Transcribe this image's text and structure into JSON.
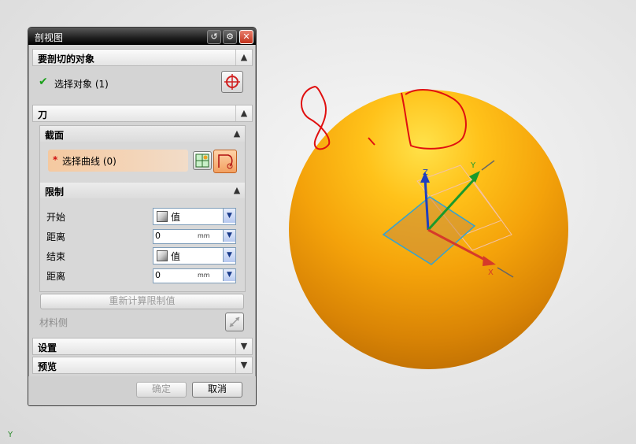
{
  "dialog": {
    "title": "剖视图",
    "section_objects": {
      "label": "要剖切的对象",
      "select_object": "选择对象 (1)"
    },
    "section_knife": {
      "label": "刀"
    },
    "section_plane": {
      "label": "截面",
      "select_curve": "选择曲线 (0)"
    },
    "section_limits": {
      "label": "限制",
      "start_label": "开始",
      "start_value": "值",
      "start_distance_label": "距离",
      "start_distance_value": "0",
      "end_label": "结束",
      "end_value": "值",
      "end_distance_label": "距离",
      "end_distance_value": "0",
      "unit": "mm",
      "recalc_button": "重新计算限制值"
    },
    "material_side_label": "材料侧",
    "section_settings": {
      "label": "设置"
    },
    "section_preview": {
      "label": "预览"
    },
    "ok_button": "确定",
    "cancel_button": "取消"
  },
  "viewport": {
    "axis_labels": {
      "x": "X",
      "y": "Y",
      "z": "Z"
    },
    "corner_axis_label": "Y",
    "sphere_color": "#f7a90c",
    "annotation_color": "#e01010"
  }
}
